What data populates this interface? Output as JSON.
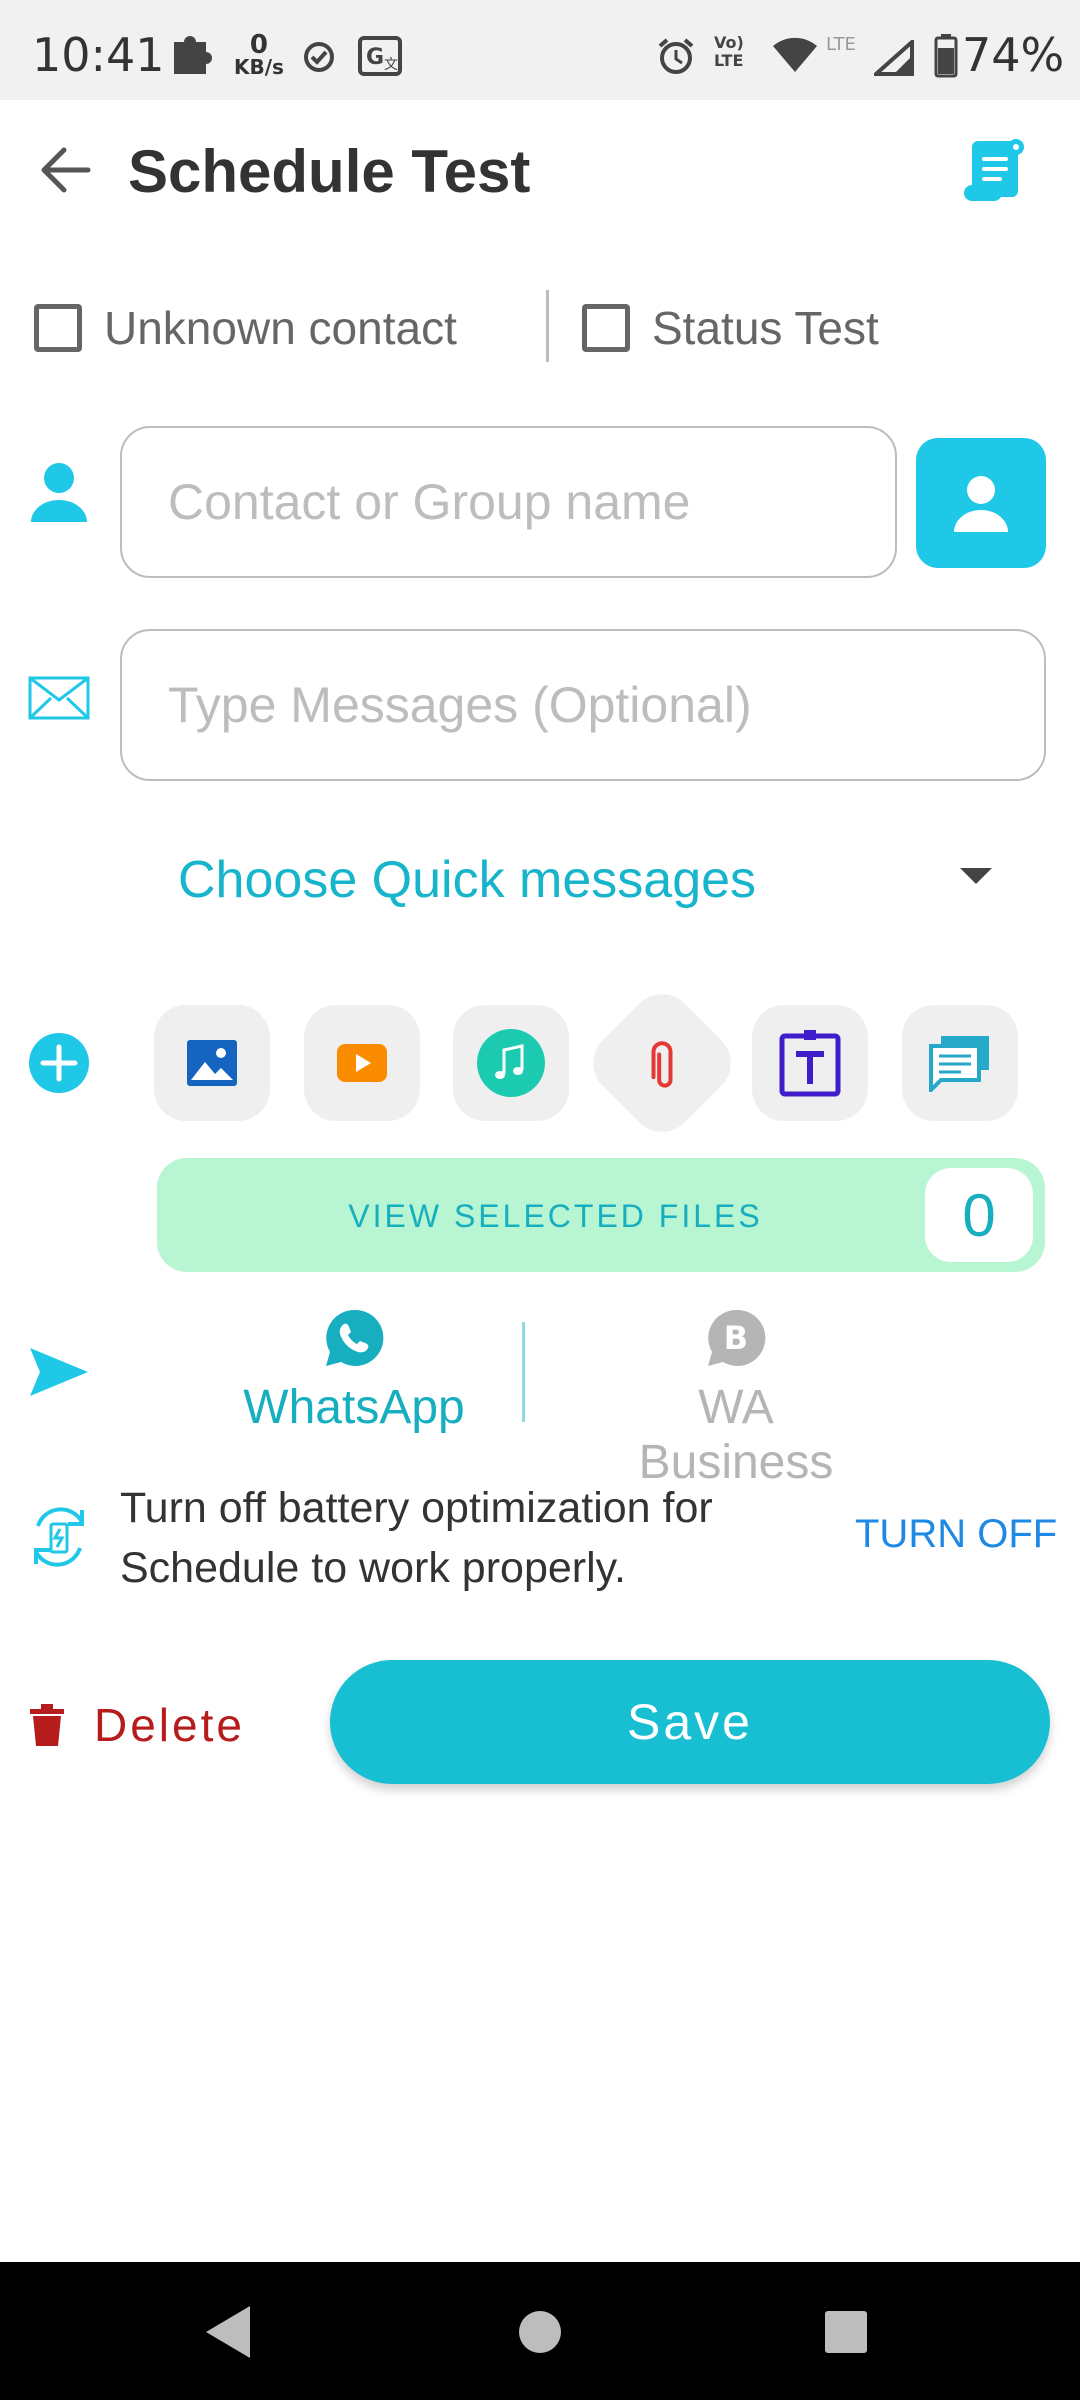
{
  "status_bar": {
    "time": "10:41",
    "net_speed_value": "0",
    "net_speed_unit": "KB/s",
    "battery": "74%",
    "icons": [
      "puzzle-icon",
      "check-circle-icon",
      "translate-icon",
      "alarm-icon",
      "volte-icon",
      "wifi-icon",
      "lte-signal-icon",
      "battery-icon"
    ],
    "network_label": "LTE"
  },
  "header": {
    "title": "Schedule Test",
    "back_icon": "arrow-left-icon",
    "action_icon": "scroll-document-icon"
  },
  "options": {
    "unknown_contact": {
      "label": "Unknown contact",
      "checked": false
    },
    "status_test": {
      "label": "Status Test",
      "checked": false
    }
  },
  "contact": {
    "placeholder": "Contact or Group name",
    "value": "",
    "picker_icon": "person-icon"
  },
  "message": {
    "placeholder": "Type Messages (Optional)",
    "value": ""
  },
  "quick_messages": {
    "label": "Choose Quick messages"
  },
  "attachments": {
    "items": [
      "image-icon",
      "video-icon",
      "music-icon",
      "paperclip-icon",
      "text-icon",
      "chat-icon"
    ]
  },
  "view_files": {
    "label": "VIEW SELECTED FILES",
    "count": "0"
  },
  "apps": {
    "whatsapp": {
      "label": "WhatsApp",
      "selected": true,
      "color": "#17aebf"
    },
    "wa_business": {
      "label": "WA Business",
      "selected": false,
      "color": "#b5b5b5",
      "badge": "B"
    }
  },
  "battery_notice": {
    "text": "Turn off battery optimization for Schedule to work properly.",
    "action": "TURN OFF"
  },
  "actions": {
    "delete": "Delete",
    "save": "Save"
  },
  "colors": {
    "accent": "#1ec8e6",
    "accent_dark": "#17aebf",
    "delete": "#b71c1c",
    "files_bg": "#b7f5d3",
    "link": "#1e88e5"
  }
}
